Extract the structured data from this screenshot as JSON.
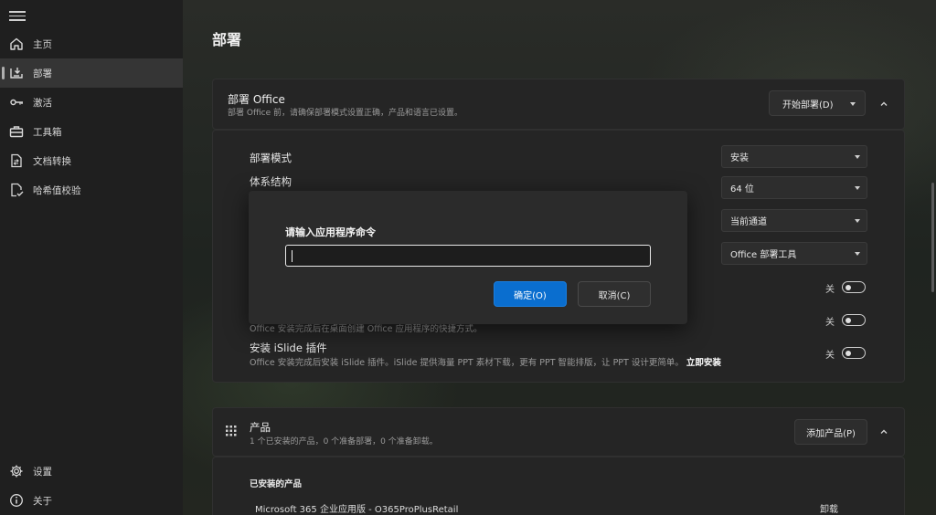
{
  "sidebar": {
    "items": [
      {
        "label": "主页",
        "icon": "home-icon"
      },
      {
        "label": "部署",
        "icon": "deploy-icon"
      },
      {
        "label": "激活",
        "icon": "key-icon"
      },
      {
        "label": "工具箱",
        "icon": "toolbox-icon"
      },
      {
        "label": "文档转换",
        "icon": "document-convert-icon"
      },
      {
        "label": "哈希值校验",
        "icon": "hash-check-icon"
      }
    ],
    "active": "部署",
    "footer": [
      {
        "label": "设置",
        "icon": "gear-icon"
      },
      {
        "label": "关于",
        "icon": "info-icon"
      }
    ]
  },
  "main": {
    "page_title": "部署",
    "deploy_card": {
      "title": "部署 Office",
      "subtitle": "部署 Office 前，请确保部署模式设置正确，产品和语言已设置。",
      "start_button": "开始部署(D)",
      "rows": {
        "mode_label": "部署模式",
        "mode_value": "安装",
        "arch_label": "体系结构",
        "arch_value": "64 位",
        "channel_value": "当前通道",
        "tool_value": "Office 部署工具",
        "shortcut_desc": "Office 安装完成后在桌面创建 Office 应用程序的快捷方式。",
        "islide_label": "安装 iSlide 插件",
        "islide_desc": "Office 安装完成后安装 iSlide 插件。iSlide 提供海量 PPT 素材下载，更有 PPT 智能排版，让 PPT 设计更简单。",
        "islide_link": "立即安装",
        "toggle_off_label": "关"
      }
    },
    "product_card": {
      "title": "产品",
      "subtitle": "1 个已安装的产品，0 个准备部署，0 个准备卸载。",
      "add_button": "添加产品(P)",
      "installed_header": "已安装的产品",
      "installed": [
        {
          "name": "Microsoft 365 企业应用版  -  O365ProPlusRetail",
          "action": "卸载"
        }
      ]
    }
  },
  "dialog": {
    "title": "请输入应用程序命令",
    "input_value": "",
    "ok_label": "确定(O)",
    "cancel_label": "取消(C)"
  },
  "colors": {
    "accent": "#0a6ecf",
    "sidebar_bg": "#1f1f1f",
    "card_bg": "#252525"
  }
}
